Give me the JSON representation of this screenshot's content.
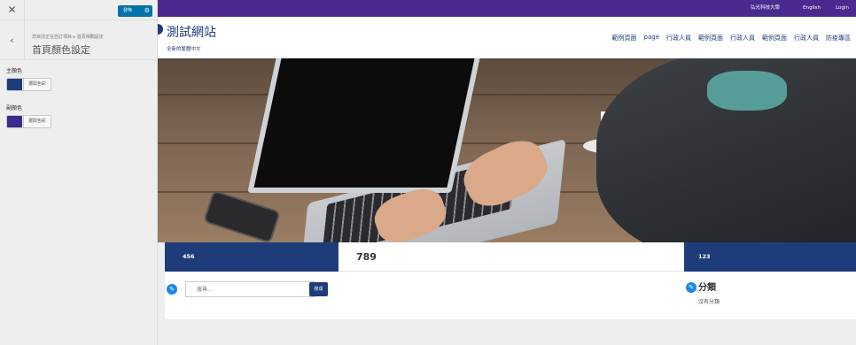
{
  "panel": {
    "publish_label": "發佈",
    "breadcrumb": "您目前正在自訂項目 ▸ 首頁相關設定",
    "section_title": "首頁顏色設定",
    "controls": [
      {
        "label": "主顏色",
        "button": "選取色彩",
        "color": "#1f3c7a"
      },
      {
        "label": "副顏色",
        "button": "選取色彩",
        "color": "#3d2a8c"
      }
    ]
  },
  "topbar": {
    "org": "弘光科技大學",
    "lang": "English",
    "login": "Login",
    "color": "#4b2a8f"
  },
  "header": {
    "title": "測試網站",
    "tagline": "全新的繁體中文",
    "nav": [
      "範例頁面",
      "page",
      "行政人員",
      "範例頁面",
      "行政人員",
      "範例頁面",
      "行政人員",
      "防疫專區"
    ]
  },
  "hero": {
    "alt": "laptop-on-desk-photo"
  },
  "columns": {
    "left": {
      "header": "456",
      "search_placeholder": "搜尋...",
      "search_button": "搜尋"
    },
    "middle": {
      "header": "789"
    },
    "right": {
      "header": "123",
      "widget_title": "分類",
      "widget_empty": "沒有分類"
    }
  },
  "colors": {
    "primary": "#1f3c7a",
    "secondary": "#3d2a8c",
    "accent": "#1e88e5"
  }
}
